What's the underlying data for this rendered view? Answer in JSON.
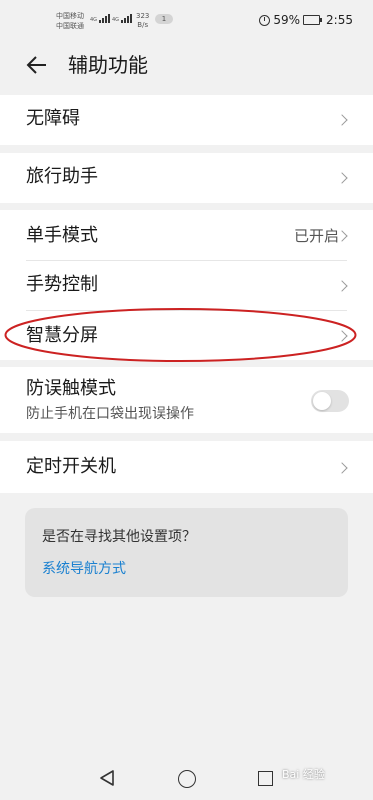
{
  "status_bar": {
    "carrier_1": "中国移动",
    "carrier_2": "中国联通",
    "net_1": "4G",
    "net_2": "4G",
    "speed_value": "323",
    "speed_unit": "B/s",
    "notification_count": "1",
    "battery": "59%",
    "battery_level": 0.59,
    "time": "2:55"
  },
  "header": {
    "title": "辅助功能"
  },
  "items": {
    "accessibility": "无障碍",
    "travel_assistant": "旅行助手",
    "one_hand_mode": "单手模式",
    "one_hand_mode_status": "已开启",
    "gesture_control": "手势控制",
    "smart_split_screen": "智慧分屏",
    "accidental_touch": "防误触模式",
    "accidental_touch_desc": "防止手机在口袋出现误操作",
    "accidental_touch_enabled": false,
    "scheduled_power": "定时开关机"
  },
  "suggestion": {
    "question": "是否在寻找其他设置项？",
    "link": "系统导航方式"
  },
  "watermark": "Bai 经验",
  "colors": {
    "page_bg": "#f1f1f1",
    "card_bg": "#e3e3e3",
    "link": "#1a80d0",
    "highlight_ellipse": "#cc2222"
  }
}
